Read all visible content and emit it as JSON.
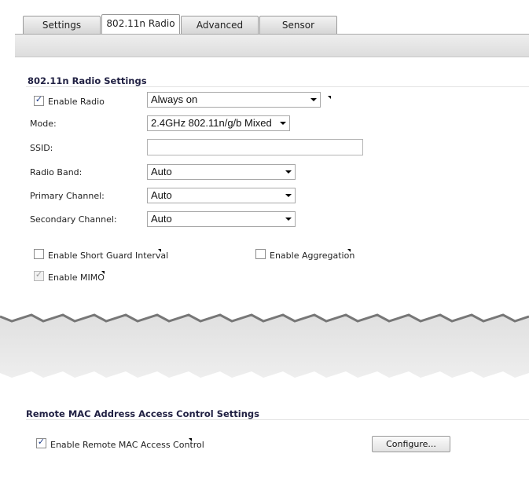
{
  "tabs": [
    {
      "label": "Settings",
      "active": false
    },
    {
      "label": "802.11n Radio",
      "active": true
    },
    {
      "label": "Advanced",
      "active": false
    },
    {
      "label": "Sensor",
      "active": false
    }
  ],
  "radio_settings": {
    "title": "802.11n Radio Settings",
    "enable_radio": {
      "label": "Enable Radio",
      "checked": true
    },
    "schedule_select": {
      "value": "Always on"
    },
    "mode": {
      "label": "Mode:",
      "value": "2.4GHz 802.11n/g/b Mixed"
    },
    "ssid": {
      "label": "SSID:",
      "value": ""
    },
    "radio_band": {
      "label": "Radio Band:",
      "value": "Auto"
    },
    "primary_channel": {
      "label": "Primary Channel:",
      "value": "Auto"
    },
    "secondary_channel": {
      "label": "Secondary Channel:",
      "value": "Auto"
    },
    "short_guard": {
      "label": "Enable Short Guard Interval",
      "checked": false
    },
    "aggregation": {
      "label": "Enable Aggregation",
      "checked": false
    },
    "mimo": {
      "label": "Enable MIMO",
      "checked": true,
      "disabled": true
    }
  },
  "remote_mac": {
    "title": "Remote MAC Address Access Control Settings",
    "enable": {
      "label": "Enable Remote MAC Access Control",
      "checked": true
    },
    "configure_label": "Configure..."
  },
  "colors": {
    "section_title": "#222244",
    "tear_fill": "#e4e4e4"
  },
  "icons": {
    "check": "✓",
    "tooltip": "tooltip-triangle-icon",
    "dropdown": "chevron-down-icon"
  }
}
